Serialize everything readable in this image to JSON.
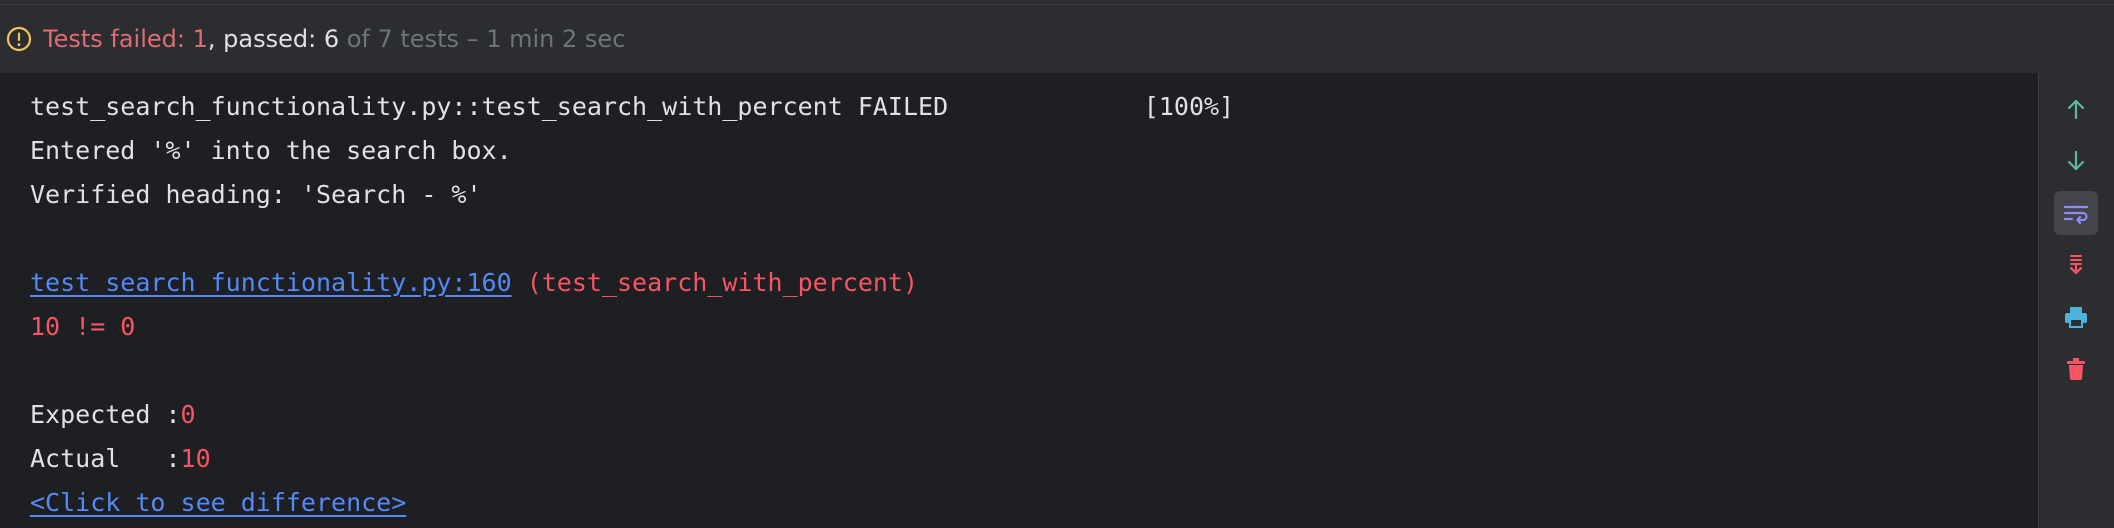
{
  "status": {
    "failed_label": "Tests failed: ",
    "failed_count": "1",
    "passed_label": ", passed: 6",
    "summary": " of 7 tests – 1 min 2 sec",
    "icon": "warning-circle-icon",
    "failed_color": "#e06c75"
  },
  "console": {
    "lines": [
      "test_search_functionality.py::test_search_with_percent FAILED             [100%]",
      "Entered '%' into the search box.",
      "Verified heading: 'Search - %'"
    ],
    "trace_link": "test_search_functionality.py:160",
    "trace_context": " (test_search_with_percent)",
    "assert_message": "10 != 0",
    "expected_label": "Expected :",
    "expected_value": "0",
    "actual_label": "Actual   :",
    "actual_value": "10",
    "diff_link": "<Click to see difference>"
  },
  "toolbar": {
    "buttons": [
      {
        "icon": "arrow-up-icon",
        "label": "Up to previous occurrence"
      },
      {
        "icon": "arrow-down-icon",
        "label": "Down to next occurrence"
      },
      {
        "icon": "soft-wrap-icon",
        "label": "Soft-wrap",
        "active": true
      },
      {
        "icon": "scroll-to-end-icon",
        "label": "Scroll to the end"
      },
      {
        "icon": "print-icon",
        "label": "Print"
      },
      {
        "icon": "trash-icon",
        "label": "Clear all"
      }
    ]
  },
  "colors": {
    "background": "#1e1f22",
    "panel": "#2b2d30",
    "text": "#dfe1e5",
    "error": "#f75464",
    "link": "#548af7",
    "muted": "#6f737a"
  }
}
